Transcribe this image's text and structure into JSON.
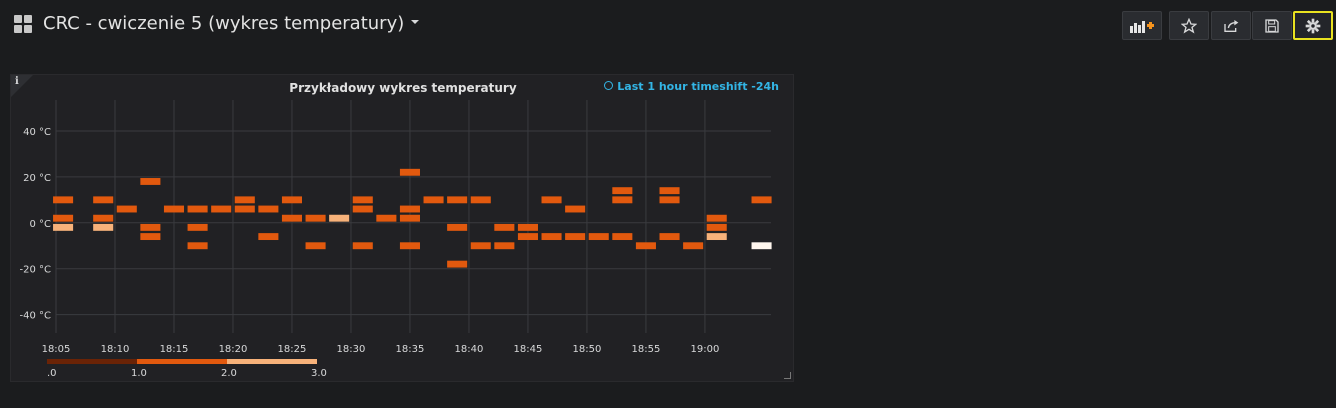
{
  "header": {
    "title": "CRC - cwiczenie 5 (wykres temperatury)",
    "buttons": [
      {
        "icon": "add-panel-icon"
      },
      {
        "icon": "star-icon"
      },
      {
        "icon": "share-icon"
      },
      {
        "icon": "save-icon"
      },
      {
        "icon": "gear-icon"
      }
    ]
  },
  "panel": {
    "info": "i",
    "title": "Przykładowy wykres temperatury",
    "time_info": "Last 1 hour timeshift -24h"
  },
  "chart_data": {
    "type": "heatmap",
    "title": "Przykładowy wykres temperatury",
    "y_ticks": [
      "40 °C",
      "20 °C",
      "0 °C",
      "-20 °C",
      "-40 °C"
    ],
    "y_tick_values": [
      40,
      20,
      0,
      -20,
      -40
    ],
    "ylim": [
      -48,
      50
    ],
    "x_ticks": [
      "18:05",
      "18:10",
      "18:15",
      "18:20",
      "18:25",
      "18:30",
      "18:35",
      "18:40",
      "18:45",
      "18:50",
      "18:55",
      "19:00"
    ],
    "x_tick_minutes": [
      0,
      5,
      10,
      15,
      20,
      25,
      30,
      35,
      40,
      45,
      50,
      55
    ],
    "xlim": [
      0,
      60.6
    ],
    "bucket_width_min": 1.7,
    "bucket_height_c": 3,
    "grid": true,
    "legend": {
      "labels": [
        ".0",
        "1.0",
        "2.0",
        "3.0"
      ],
      "range": [
        0,
        3
      ],
      "colors": [
        "#5a1a05",
        "#e2590e",
        "#f7b27a"
      ]
    },
    "cells": [
      {
        "x": 0.6,
        "y": 10,
        "count": 1
      },
      {
        "x": 0.6,
        "y": 2,
        "count": 1
      },
      {
        "x": 0.6,
        "y": -2,
        "count": 3
      },
      {
        "x": 4,
        "y": 10,
        "count": 1
      },
      {
        "x": 4,
        "y": 2,
        "count": 1
      },
      {
        "x": 4,
        "y": -2,
        "count": 3
      },
      {
        "x": 6,
        "y": 6,
        "count": 1
      },
      {
        "x": 8,
        "y": 18,
        "count": 1
      },
      {
        "x": 8,
        "y": -2,
        "count": 1
      },
      {
        "x": 8,
        "y": -6,
        "count": 1
      },
      {
        "x": 10,
        "y": 6,
        "count": 1
      },
      {
        "x": 12,
        "y": 6,
        "count": 1
      },
      {
        "x": 12,
        "y": -2,
        "count": 1
      },
      {
        "x": 12,
        "y": -10,
        "count": 1
      },
      {
        "x": 14,
        "y": 6,
        "count": 1
      },
      {
        "x": 16,
        "y": 10,
        "count": 1
      },
      {
        "x": 16,
        "y": 6,
        "count": 1
      },
      {
        "x": 18,
        "y": 6,
        "count": 1
      },
      {
        "x": 18,
        "y": -6,
        "count": 1
      },
      {
        "x": 20,
        "y": 10,
        "count": 1
      },
      {
        "x": 20,
        "y": 2,
        "count": 1
      },
      {
        "x": 22,
        "y": 2,
        "count": 1
      },
      {
        "x": 22,
        "y": -10,
        "count": 1
      },
      {
        "x": 24,
        "y": 2,
        "count": 3
      },
      {
        "x": 26,
        "y": 10,
        "count": 1
      },
      {
        "x": 26,
        "y": 6,
        "count": 1
      },
      {
        "x": 26,
        "y": -10,
        "count": 1
      },
      {
        "x": 28,
        "y": 2,
        "count": 1
      },
      {
        "x": 30,
        "y": 22,
        "count": 1
      },
      {
        "x": 30,
        "y": 6,
        "count": 1
      },
      {
        "x": 30,
        "y": 2,
        "count": 1
      },
      {
        "x": 30,
        "y": -10,
        "count": 1
      },
      {
        "x": 32,
        "y": 10,
        "count": 1
      },
      {
        "x": 34,
        "y": 10,
        "count": 1
      },
      {
        "x": 34,
        "y": -2,
        "count": 1
      },
      {
        "x": 34,
        "y": -18,
        "count": 1
      },
      {
        "x": 36,
        "y": 10,
        "count": 1
      },
      {
        "x": 36,
        "y": -10,
        "count": 1
      },
      {
        "x": 38,
        "y": -2,
        "count": 1
      },
      {
        "x": 38,
        "y": -10,
        "count": 1
      },
      {
        "x": 40,
        "y": -2,
        "count": 1
      },
      {
        "x": 40,
        "y": -6,
        "count": 1
      },
      {
        "x": 42,
        "y": 10,
        "count": 1
      },
      {
        "x": 42,
        "y": -6,
        "count": 1
      },
      {
        "x": 44,
        "y": 6,
        "count": 1
      },
      {
        "x": 44,
        "y": -6,
        "count": 1
      },
      {
        "x": 46,
        "y": -6,
        "count": 1
      },
      {
        "x": 48,
        "y": 14,
        "count": 1
      },
      {
        "x": 48,
        "y": 10,
        "count": 1
      },
      {
        "x": 48,
        "y": -6,
        "count": 1
      },
      {
        "x": 50,
        "y": -10,
        "count": 1
      },
      {
        "x": 52,
        "y": 14,
        "count": 1
      },
      {
        "x": 52,
        "y": 10,
        "count": 1
      },
      {
        "x": 52,
        "y": -6,
        "count": 1
      },
      {
        "x": 54,
        "y": -10,
        "count": 1
      },
      {
        "x": 56,
        "y": 2,
        "count": 1
      },
      {
        "x": 56,
        "y": -2,
        "count": 1
      },
      {
        "x": 56,
        "y": -6,
        "count": 3
      },
      {
        "x": 59.8,
        "y": 10,
        "count": 1
      },
      {
        "x": 59.8,
        "y": -10,
        "count": 4
      }
    ]
  }
}
